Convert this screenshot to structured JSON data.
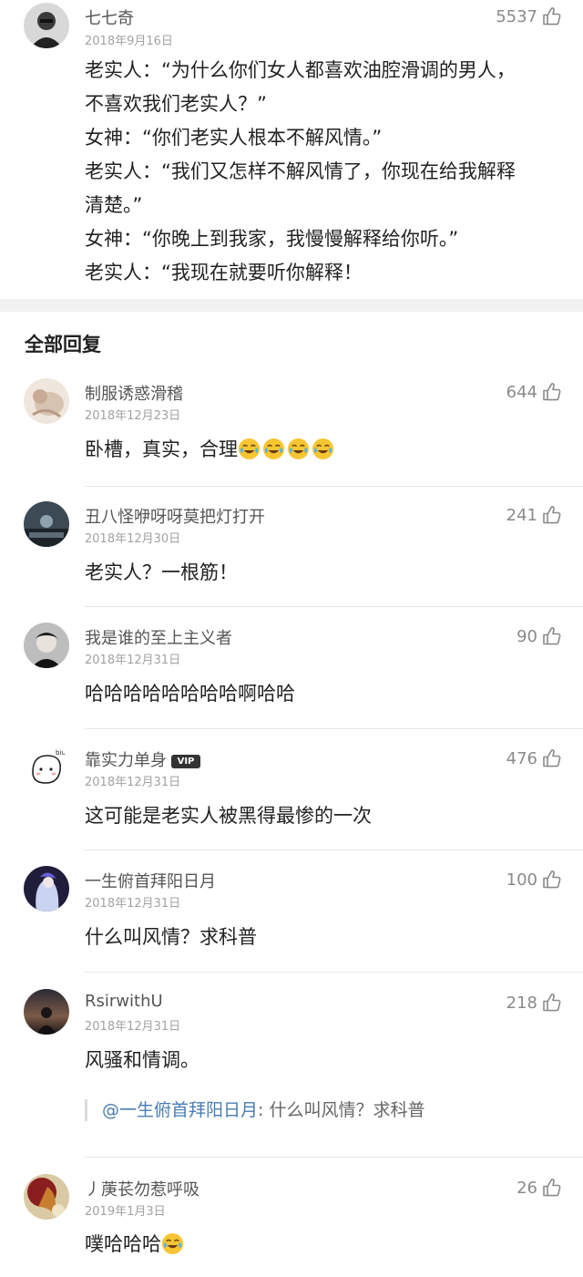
{
  "main_post": {
    "username": "七七奇",
    "date": "2018年9月16日",
    "likes": "5537",
    "lines": [
      "老实人：“为什么你们女人都喜欢油腔滑调的男人，",
      "不喜欢我们老实人？”",
      "女神：“你们老实人根本不解风情。”",
      "老实人：“我们又怎样不解风情了，你现在给我解释",
      "清楚。”",
      "女神：“你晚上到我家，我慢慢解释给你听。”",
      "老实人：“我现在就要听你解释！"
    ]
  },
  "replies_section": {
    "title": "全部回复"
  },
  "replies": [
    {
      "username": "制服诱惑滑稽",
      "date": "2018年12月23日",
      "likes": "644",
      "text": "卧槽，真实，合理",
      "emoji_count": 4
    },
    {
      "username": "丑八怪咿呀呀莫把灯打开",
      "date": "2018年12月30日",
      "likes": "241",
      "text": "老实人？一根筋！"
    },
    {
      "username": "我是谁的至上主义者",
      "date": "2018年12月31日",
      "likes": "90",
      "text": "哈哈哈哈哈哈哈哈啊哈哈"
    },
    {
      "username": "靠实力单身",
      "badge": "VIP",
      "date": "2018年12月31日",
      "likes": "476",
      "text": "这可能是老实人被黑得最惨的一次"
    },
    {
      "username": "一生俯首拜阳日月",
      "date": "2018年12月31日",
      "likes": "100",
      "text": "什么叫风情？求科普"
    },
    {
      "username": "RsirwithU",
      "date": "2018年12月31日",
      "likes": "218",
      "text": "风骚和情调。",
      "quote_mention": "@一生俯首拜阳日月",
      "quote_text": ": 什么叫风情？求科普"
    },
    {
      "username": "丿菮苌勿惹呼吸",
      "date": "2019年1月3日",
      "likes": "26",
      "text": "噗哈哈哈",
      "emoji_count": 1
    }
  ],
  "icons": {
    "like": "thumbs-up-icon",
    "emoji": "laughing-tears-emoji"
  },
  "colors": {
    "mention": "#4a7cb1",
    "meta": "#a2a2a2",
    "section_gap": "#f2f2f2"
  }
}
